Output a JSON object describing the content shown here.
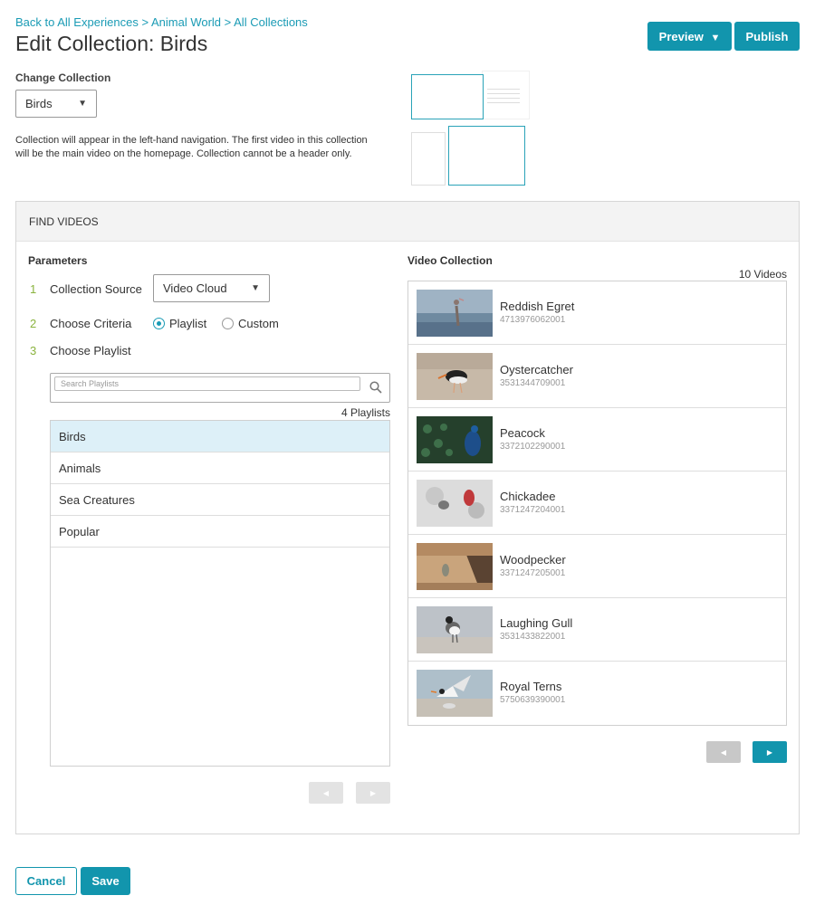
{
  "breadcrumb": {
    "back": "Back to All Experiences",
    "sep1": " > ",
    "level1": "Animal World",
    "sep2": " > ",
    "level2": "All Collections"
  },
  "page_title": "Edit Collection: Birds",
  "header_buttons": {
    "preview": "Preview",
    "preview_caret": "▼",
    "publish": "Publish"
  },
  "change_collection": {
    "label": "Change Collection",
    "selected": "Birds",
    "help": "Collection will appear in the left-hand navigation. The first video in this collection will be the main video on the homepage. Collection cannot be a header only."
  },
  "find_videos": {
    "header": "FIND VIDEOS",
    "parameters_label": "Parameters",
    "steps": [
      {
        "num": "1",
        "label": "Collection Source"
      },
      {
        "num": "2",
        "label": "Choose Criteria"
      },
      {
        "num": "3",
        "label": "Choose Playlist"
      }
    ],
    "source_selected": "Video Cloud",
    "criteria": {
      "options": [
        "Playlist",
        "Custom"
      ],
      "selected": "Playlist"
    },
    "search_placeholder": "Search Playlists",
    "playlist_count": "4 Playlists",
    "playlists": [
      "Birds",
      "Animals",
      "Sea Creatures",
      "Popular"
    ],
    "active_playlist": "Birds"
  },
  "video_collection": {
    "label": "Video Collection",
    "count": "10 Videos",
    "videos": [
      {
        "name": "Reddish Egret",
        "id": "4713976062001"
      },
      {
        "name": "Oystercatcher",
        "id": "3531344709001"
      },
      {
        "name": "Peacock",
        "id": "3372102290001"
      },
      {
        "name": "Chickadee",
        "id": "3371247204001"
      },
      {
        "name": "Woodpecker",
        "id": "3371247205001"
      },
      {
        "name": "Laughing Gull",
        "id": "3531433822001"
      },
      {
        "name": "Royal Terns",
        "id": "5750639390001"
      }
    ]
  },
  "pager": {
    "prev": "◀",
    "next": "▶"
  },
  "footer": {
    "cancel": "Cancel",
    "save": "Save"
  },
  "colors": {
    "accent": "#1295ad",
    "step_number": "#8ab33e",
    "active_row": "#ddf0f8"
  }
}
